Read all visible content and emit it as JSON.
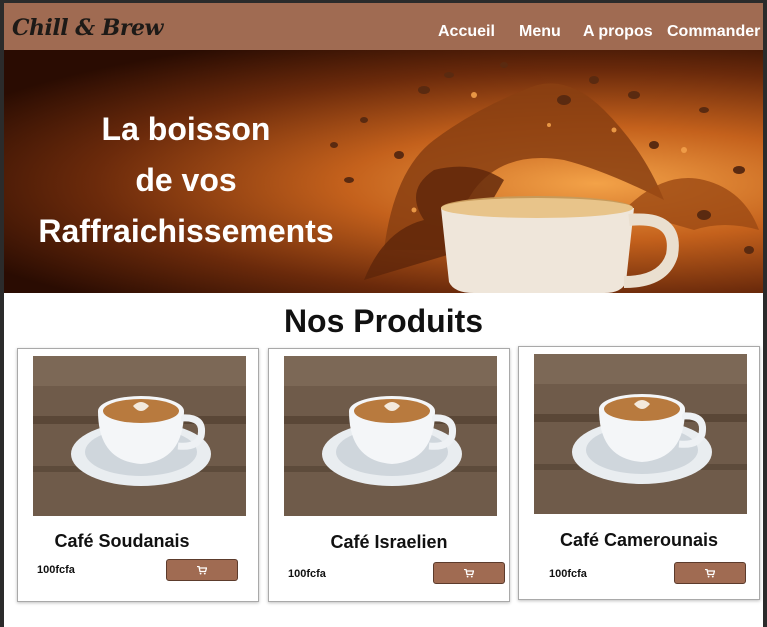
{
  "header": {
    "logo": "Chill & Brew",
    "nav": [
      "Accueil",
      "Menu",
      "A propos",
      "Commander"
    ]
  },
  "hero": {
    "title_lines": [
      "La boisson",
      "de vos",
      "Raffraichissements"
    ]
  },
  "products": {
    "title": "Nos Produits",
    "items": [
      {
        "name": "Café Soudanais",
        "price": "100fcfa"
      },
      {
        "name": "Café Israelien",
        "price": "100fcfa"
      },
      {
        "name": "Café Camerounais",
        "price": "100fcfa"
      }
    ],
    "cart_icon": "cart-icon"
  },
  "colors": {
    "brand": "#a06b52",
    "hero_dark": "#2a0c02",
    "hero_light": "#f3a248"
  }
}
